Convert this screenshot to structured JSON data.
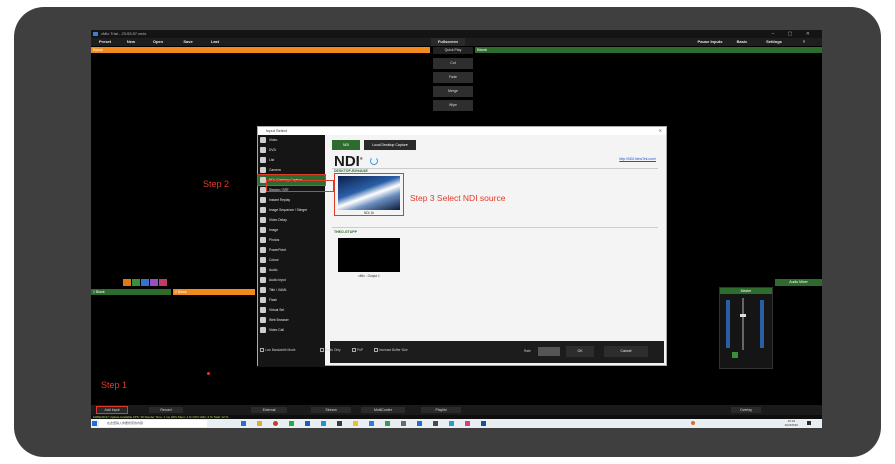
{
  "window": {
    "title": "vMix Trial - 23:53:57.vmix",
    "controls": "– ▢ ✕"
  },
  "menu": {
    "preset": "Preset",
    "new": "New",
    "open": "Open",
    "save": "Save",
    "last": "Last",
    "fullscreen": "Fullscreen",
    "pause_inputs": "Pause Inputs",
    "basic": "Basic",
    "settings": "Settings",
    "help": "?"
  },
  "preview": {
    "label": "Blank"
  },
  "output": {
    "label": "Blank"
  },
  "transitions": {
    "quick_play": "Quick Play",
    "cut": "Cut",
    "fade": "Fade",
    "merge": "Merge",
    "wipe": "Wipe"
  },
  "steps": {
    "step1": "Step 1",
    "step2": "Step 2",
    "step3": "Step 3   Select NDI source"
  },
  "dialog": {
    "title": "Input Select",
    "close": "✕",
    "sidebar": [
      "Video",
      "DVD",
      "List",
      "Camera",
      "NDI / Desktop Capture",
      "Stream / SRT",
      "Instant Replay",
      "Image Sequence / Stinger",
      "Video Delay",
      "Image",
      "Photos",
      "PowerPoint",
      "Colour",
      "Audio",
      "Audio Input",
      "Title / XAML",
      "Flash",
      "Virtual Set",
      "Web Browser",
      "Video Call"
    ],
    "tabs": {
      "ndi": "NDI",
      "desktop": "Local Desktop Capture"
    },
    "logo": "NDI",
    "logo_mark": "®",
    "link": "http://NDI.NewTek.com/",
    "group1": "DESKTOP-R2H4U4E",
    "source1": "NDI-1b",
    "group2": "THEO-GTUPP",
    "source2": "vMix - Output 1",
    "checkboxes": [
      "Low Bandwidth Mode",
      "Audio Only",
      "PnP",
      "Increase Buffer Size"
    ],
    "rate_label": "Rate",
    "ok": "OK",
    "cancel": "Cancel"
  },
  "mini": {
    "m1": "1 Blank",
    "m2": "2 Blank"
  },
  "audio": {
    "title": "Audio Mixer",
    "master": "Master"
  },
  "bottom": {
    "add_input": "Add Input",
    "record": "Record",
    "external": "External",
    "stream": "Stream",
    "multicorder": "MultiCorder",
    "playlist": "Playlist",
    "overlay": "Overlay"
  },
  "status": {
    "text": "1080p29.97   Update Available   FPS: 30  Render Time: 1 ms  GPU Mem: 1 %  CPU vMix: 2 %  Total: 12 %"
  },
  "taskbar": {
    "search": "在这里输入你要搜索的内容",
    "time": "15:34",
    "date": "2023/8/30"
  },
  "colors": {
    "accent_orange": "#f28a1c",
    "accent_green": "#2e6b2e",
    "highlight_red": "#e23a2a"
  }
}
